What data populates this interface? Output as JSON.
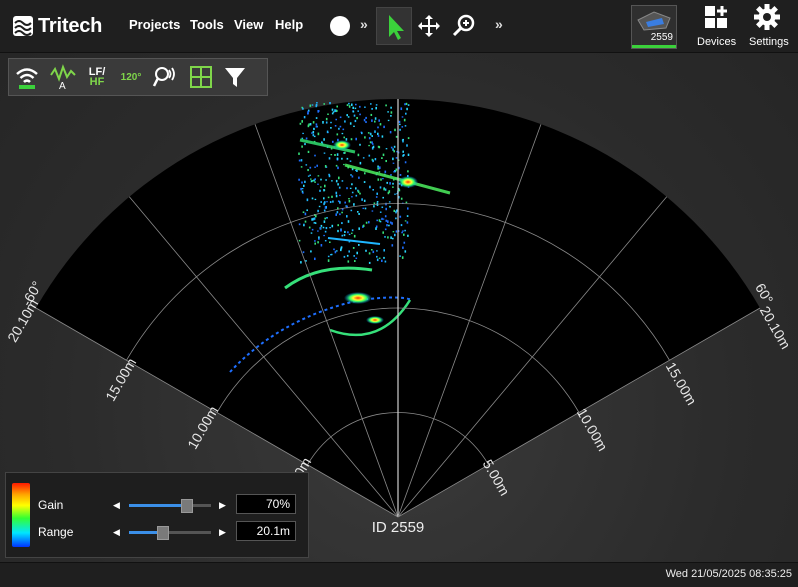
{
  "app": {
    "logo_text": "Tritech"
  },
  "menu": {
    "projects": "Projects",
    "tools": "Tools",
    "view": "View",
    "help": "Help"
  },
  "toolbar": {
    "chevron": "»",
    "device_id": "2559",
    "devices_label": "Devices",
    "settings_label": "Settings"
  },
  "tools": {
    "lfhf_top": "LF/",
    "lfhf_a": "A",
    "lfhf_bottom": "HF",
    "aperture": "120°"
  },
  "sonar": {
    "left_angle": "-60°",
    "right_angle": "60°",
    "left_range_max": "20.10m",
    "right_range_max": "20.10m",
    "left_rings": [
      "15.00m",
      "10.00m",
      "5.00m"
    ],
    "right_rings": [
      "15.00m",
      "10.00m",
      "5.00m"
    ],
    "device_label": "ID 2559"
  },
  "controls": {
    "gain": {
      "label": "Gain",
      "value": "70%",
      "level": 0.7
    },
    "range": {
      "label": "Range",
      "value": "20.1m",
      "level": 0.4
    }
  },
  "status": {
    "datetime": "Wed 21/05/2025 08:35:25"
  },
  "colors": {
    "accent_green": "#7fd64a",
    "slider_blue": "#3b8fe8"
  }
}
